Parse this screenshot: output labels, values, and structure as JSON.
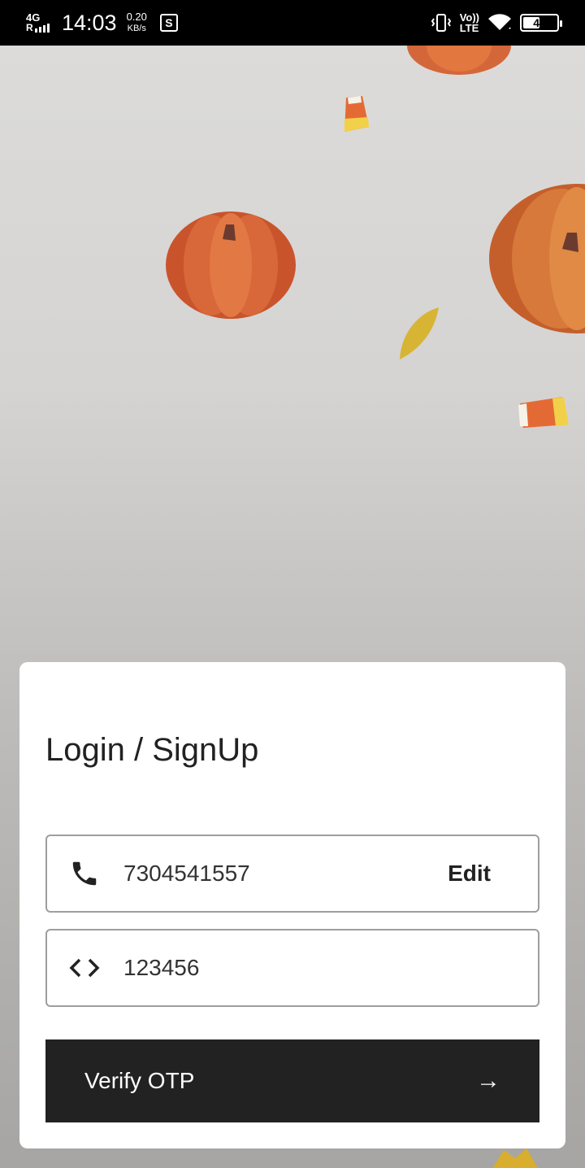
{
  "status_bar": {
    "network_type": "4G",
    "roaming": "R",
    "time": "14:03",
    "speed_value": "0.20",
    "speed_unit": "KB/s",
    "badge": "S",
    "volte_top": "Vo))",
    "volte_bottom": "LTE",
    "battery": "47"
  },
  "login": {
    "title": "Login / SignUp",
    "phone_value": "7304541557",
    "edit_label": "Edit",
    "otp_value": "123456",
    "verify_label": "Verify OTP",
    "verify_arrow": "→"
  },
  "icons": {
    "phone": "phone-icon",
    "code": "code-icon",
    "arrow": "arrow-right-icon"
  }
}
